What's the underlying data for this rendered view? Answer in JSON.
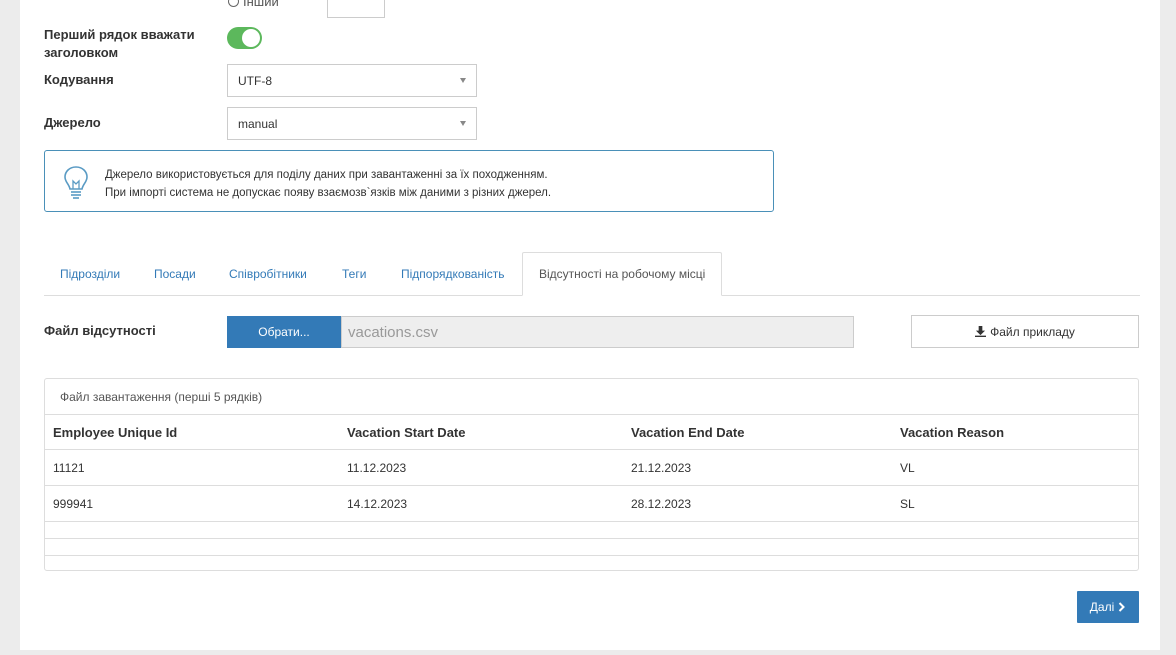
{
  "format": {
    "other_label": "Інший",
    "header_row_label_line1": "Перший рядок вважати",
    "header_row_label_line2": "заголовком",
    "header_row_enabled": true,
    "encoding_label": "Кодування",
    "encoding_value": "UTF-8",
    "source_label": "Джерело",
    "source_value": "manual"
  },
  "info": {
    "line1": "Джерело використовується для поділу даних при завантаженні за їх походженням.",
    "line2": "При імпорті система не допускає появу взаємозв`язків між даними з різних джерел."
  },
  "tabs": [
    {
      "label": "Підрозділи"
    },
    {
      "label": "Посади"
    },
    {
      "label": "Співробітники"
    },
    {
      "label": "Теги"
    },
    {
      "label": "Підпорядкованість"
    },
    {
      "label": "Відсутності на робочому місці"
    }
  ],
  "upload": {
    "label": "Файл відсутності",
    "browse_label": "Обрати...",
    "file_name": "vacations.csv",
    "sample_label": "Файл прикладу"
  },
  "preview": {
    "title": "Файл завантаження (перші 5 рядків)",
    "columns": [
      "Employee Unique Id",
      "Vacation Start Date",
      "Vacation End Date",
      "Vacation Reason"
    ],
    "rows": [
      [
        "11121",
        "11.12.2023",
        "21.12.2023",
        "VL"
      ],
      [
        "999941",
        "14.12.2023",
        "28.12.2023",
        "SL"
      ]
    ]
  },
  "next_label": "Далі",
  "colors": {
    "primary": "#337ab7",
    "toggle_on": "#5cb85c",
    "info_border": "#4a90b8"
  }
}
